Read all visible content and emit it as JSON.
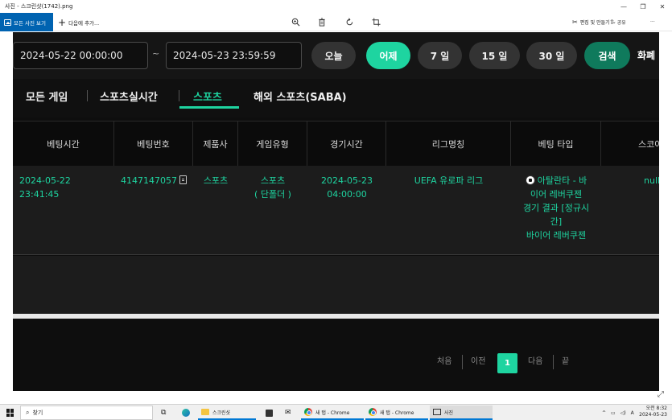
{
  "window": {
    "title": "사진 - 스크린샷(1742).png",
    "controls": [
      "—",
      "❐",
      "✕"
    ]
  },
  "toolbar": {
    "all_photos": "모든 사진 보기",
    "add_to": "다음에 추가...",
    "edit_create": "편집 및 만들기",
    "share": "공유",
    "more": "···"
  },
  "filters": {
    "start_date": "2024-05-22 00:00:00",
    "tilde": "~",
    "end_date": "2024-05-23 23:59:59",
    "buttons": [
      "오늘",
      "어제",
      "7 일",
      "15 일",
      "30 일"
    ],
    "active_button": "어제",
    "search": "검색",
    "overflow_label": "화폐"
  },
  "tabs": [
    {
      "label": "모든 게임",
      "active": false
    },
    {
      "label": "스포츠실시간",
      "active": false
    },
    {
      "label": "스포츠",
      "active": true
    },
    {
      "label": "해외 스포츠(SABA)",
      "active": false
    }
  ],
  "table": {
    "headers": [
      "베팅시간",
      "베팅번호",
      "제품사",
      "게임유형",
      "경기시간",
      "리그명칭",
      "베팅 타입",
      "스코어"
    ],
    "rows": [
      {
        "bet_time": "2024-05-22 23:41:45",
        "bet_no": "4147147057",
        "provider": "스포츠",
        "game_type_1": "스포츠",
        "game_type_2": "( 단폴더 )",
        "match_date": "2024-05-23",
        "match_clock": "04:00:00",
        "league": "UEFA 유로파 리그",
        "bet_line_1": "아탈란타 - 바",
        "bet_line_2": "이어 레버쿠젠",
        "bet_line_3": "경기 결과 [정규시",
        "bet_line_4": "간]",
        "bet_line_5": "바이어 레버쿠젠",
        "score": "null"
      }
    ]
  },
  "pagination": {
    "first": "처음",
    "prev": "이전",
    "current": "1",
    "next": "다음",
    "last": "끝"
  },
  "taskbar": {
    "search": "찾기",
    "apps": [
      "스크린샷",
      "새 탭 - Chrome",
      "새 탭 - Chrome",
      "사진"
    ],
    "lang": "A",
    "time": "오전 8:32",
    "date": "2024-05-23"
  },
  "colors": {
    "accent": "#1ed4a0",
    "search_button": "#0f7a5c",
    "windows_blue": "#0063b1"
  }
}
